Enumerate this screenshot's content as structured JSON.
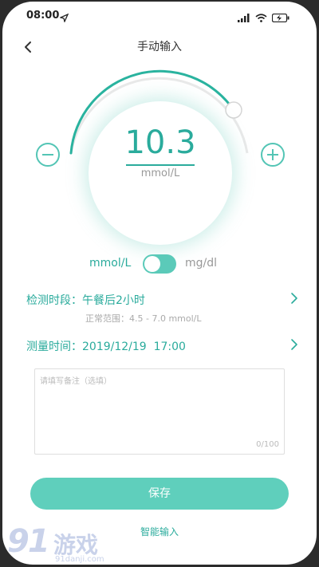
{
  "status_bar": {
    "time": "08:00",
    "icons": [
      "location-arrow-icon",
      "signal-icon",
      "wifi-icon",
      "battery-charging-icon"
    ]
  },
  "header": {
    "title": "手动输入",
    "back_icon": "chevron-left-icon"
  },
  "dial": {
    "value": "10.3",
    "unit": "mmol/L",
    "decrement_icon": "minus-circle-icon",
    "increment_icon": "plus-circle-icon",
    "accent_color": "#2aab9c"
  },
  "unit_toggle": {
    "left_label": "mmol/L",
    "right_label": "mg/dl",
    "selected": "mmol/L"
  },
  "detection_period": {
    "label": "检测时段：",
    "value": "午餐后2小时",
    "normal_range": "正常范围：4.5 - 7.0 mmol/L"
  },
  "measure_time": {
    "label": "测量时间：",
    "value": "2019/12/19  17:00"
  },
  "remark": {
    "placeholder": "请填写备注（选填）",
    "counter": "0/100"
  },
  "actions": {
    "save_label": "保存",
    "smart_input_label": "智能输入"
  },
  "watermark": {
    "logo": "91",
    "title": "游戏",
    "url": "91danji.com"
  }
}
